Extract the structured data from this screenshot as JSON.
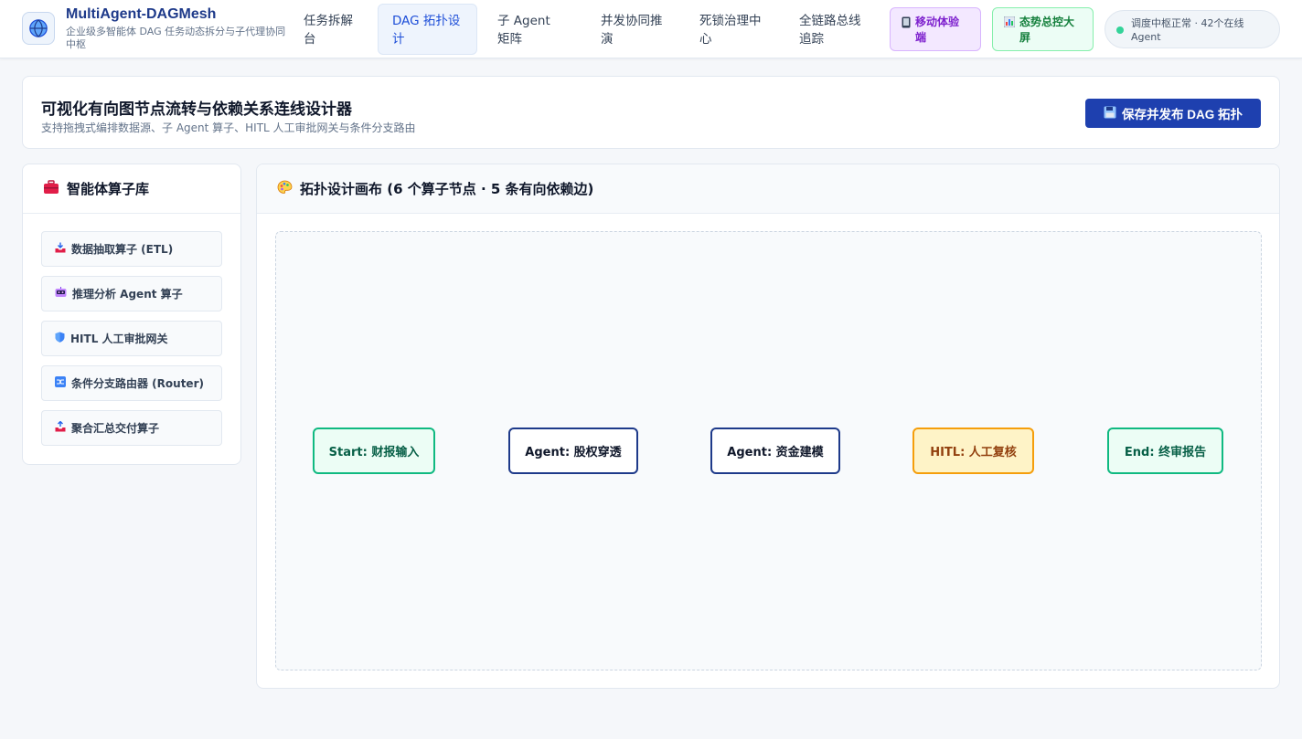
{
  "brand": {
    "title": "MultiAgent-DAGMesh",
    "subtitle": "企业级多智能体 DAG 任务动态拆分与子代理协同中枢"
  },
  "nav": {
    "tabs": [
      {
        "label": "任务拆解台",
        "active": false
      },
      {
        "label": "DAG 拓扑设计",
        "active": true
      },
      {
        "label": "子 Agent 矩阵",
        "active": false
      },
      {
        "label": "并发协同推演",
        "active": false
      },
      {
        "label": "死锁治理中心",
        "active": false
      },
      {
        "label": "全链路总线追踪",
        "active": false
      }
    ],
    "mobile_label": "移动体验端",
    "screen_label": "态势总控大屏",
    "status_text": "调度中枢正常 · 42个在线 Agent"
  },
  "header": {
    "title": "可视化有向图节点流转与依赖关系连线设计器",
    "subtitle": "支持拖拽式编排数据源、子 Agent 算子、HITL 人工审批网关与条件分支路由",
    "publish_label": "保存并发布 DAG 拓扑"
  },
  "library": {
    "title": "智能体算子库",
    "items": [
      {
        "label": "数据抽取算子 (ETL)",
        "icon": "inbox-tray-icon"
      },
      {
        "label": "推理分析 Agent 算子",
        "icon": "robot-icon"
      },
      {
        "label": "HITL 人工审批网关",
        "icon": "shield-icon"
      },
      {
        "label": "条件分支路由器 (Router)",
        "icon": "shuffle-icon"
      },
      {
        "label": "聚合汇总交付算子",
        "icon": "outbox-tray-icon"
      }
    ]
  },
  "canvas": {
    "title": "拓扑设计画布 (6 个算子节点 · 5 条有向依赖边)",
    "nodes": [
      {
        "label": "Start: 财报输入",
        "kind": "start"
      },
      {
        "label": "Agent: 股权穿透",
        "kind": "agent"
      },
      {
        "label": "Agent: 资金建模",
        "kind": "agent"
      },
      {
        "label": "HITL: 人工复核",
        "kind": "hitl"
      },
      {
        "label": "End: 终审报告",
        "kind": "end"
      }
    ]
  },
  "colors": {
    "brand_blue": "#1e3a8a",
    "primary_button": "#1e40af",
    "success_green": "#10b981",
    "warning_amber": "#f59e0b",
    "mobile_purple": "#7e22ce"
  }
}
